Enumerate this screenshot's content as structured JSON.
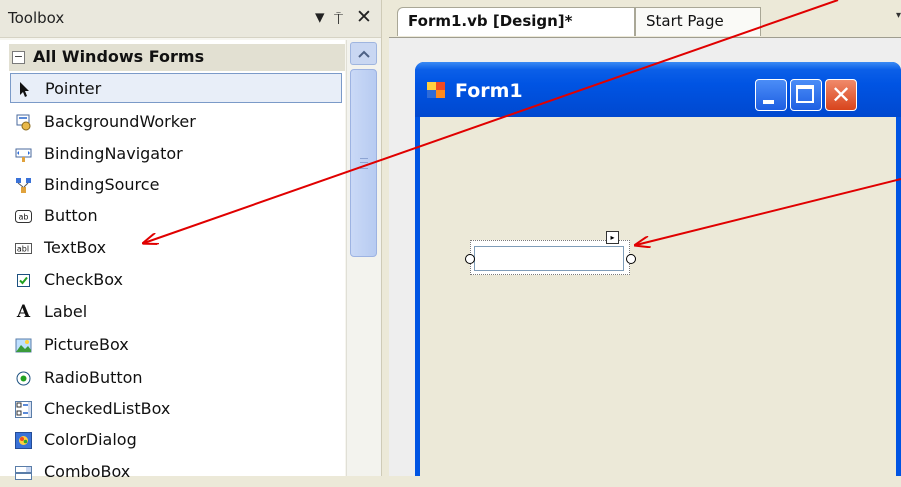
{
  "toolbox": {
    "title": "Toolbox",
    "pin_glyph": "▾",
    "autohide_glyph": "⍑",
    "close_glyph": "✕",
    "category": {
      "sign": "−",
      "label": "All Windows Forms"
    },
    "items": [
      {
        "label": "Pointer",
        "icon": "pointer-icon",
        "selected": true
      },
      {
        "label": "BackgroundWorker",
        "icon": "backgroundworker-icon"
      },
      {
        "label": "BindingNavigator",
        "icon": "bindingnavigator-icon"
      },
      {
        "label": "BindingSource",
        "icon": "bindingsource-icon"
      },
      {
        "label": "Button",
        "icon": "button-icon"
      },
      {
        "label": "TextBox",
        "icon": "textbox-icon"
      },
      {
        "label": "CheckBox",
        "icon": "checkbox-icon"
      },
      {
        "label": "Label",
        "icon": "label-icon"
      },
      {
        "label": "PictureBox",
        "icon": "picturebox-icon"
      },
      {
        "label": "RadioButton",
        "icon": "radiobutton-icon"
      },
      {
        "label": "CheckedListBox",
        "icon": "checkedlistbox-icon"
      },
      {
        "label": "ColorDialog",
        "icon": "colordialog-icon"
      },
      {
        "label": "ComboBox",
        "icon": "combobox-icon"
      }
    ]
  },
  "tabs": {
    "active": "Form1.vb [Design]*",
    "other": "Start Page",
    "more_glyph": "▾"
  },
  "form": {
    "title": "Form1",
    "close_glyph": "✕",
    "smart_tag_glyph": "▸"
  },
  "colors": {
    "titlebar": "#0054e3",
    "form_client": "#ece9d8",
    "annotation_arrow": "#e00000"
  }
}
